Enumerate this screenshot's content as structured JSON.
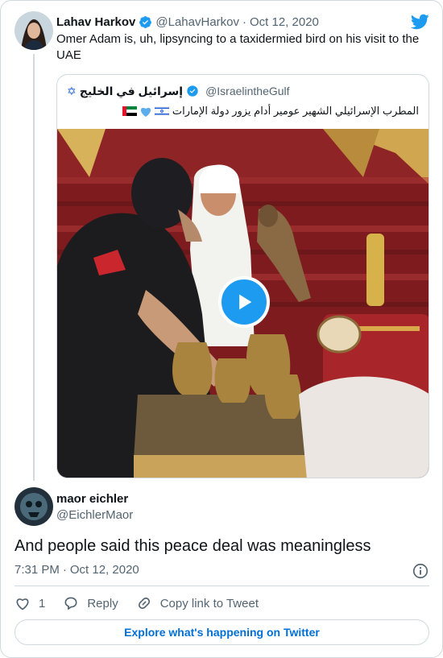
{
  "parent": {
    "name": "Lahav Harkov",
    "handle": "@LahavHarkov",
    "separator": "·",
    "date": "Oct 12, 2020",
    "text": "Omer Adam is, uh, lipsyncing to a taxidermied bird on his visit to the UAE"
  },
  "quoted": {
    "name": "إسرائيل في الخليج",
    "handle": "@IsraelintheGulf",
    "text": "المطرب الإسرائيلي الشهير عومير أدام يزور دولة الإمارات",
    "emoji_names": [
      "uae-flag-icon",
      "blue-heart-icon",
      "israel-flag-icon"
    ],
    "media_type": "video"
  },
  "reply": {
    "name": "maor eichler",
    "handle": "@EichlerMaor",
    "text": "And people said this peace deal was meaningless",
    "time": "7:31 PM",
    "separator": "·",
    "date": "Oct 12, 2020"
  },
  "actions": {
    "like_count": "1",
    "reply_label": "Reply",
    "copy_label": "Copy link to Tweet"
  },
  "explore_label": "Explore what's happening on Twitter",
  "colors": {
    "twitter_blue": "#1d9bf0",
    "link_blue": "#006fd6",
    "secondary_text": "#536471",
    "border": "#cfd9de"
  }
}
